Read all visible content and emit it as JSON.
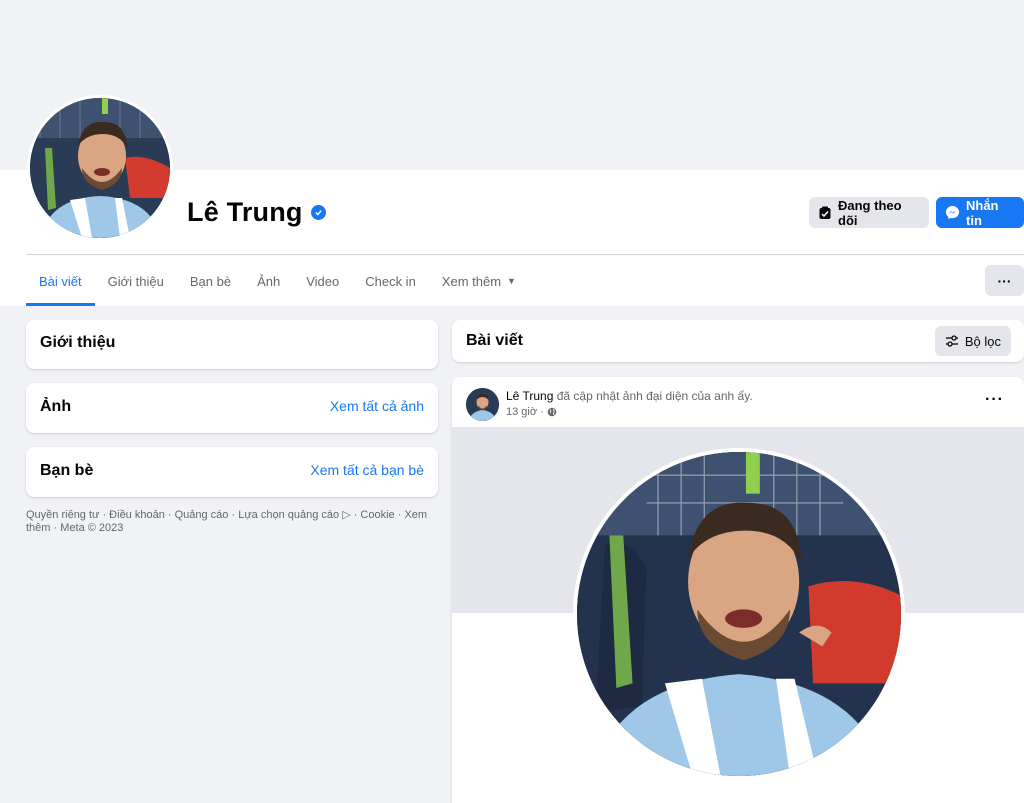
{
  "profile": {
    "name": "Lê Trung",
    "verified_icon": "verified-badge-icon"
  },
  "actions": {
    "follow_label": "Đang theo dõi",
    "message_label": "Nhắn tin"
  },
  "tabs": [
    {
      "label": "Bài viết",
      "active": true
    },
    {
      "label": "Giới thiệu"
    },
    {
      "label": "Bạn bè"
    },
    {
      "label": "Ảnh"
    },
    {
      "label": "Video"
    },
    {
      "label": "Check in"
    },
    {
      "label": "Xem thêm"
    }
  ],
  "more_button": "···",
  "left": {
    "intro_title": "Giới thiệu",
    "photos_title": "Ảnh",
    "photos_link": "Xem tất cả ảnh",
    "friends_title": "Bạn bè",
    "friends_link": "Xem tất cả bạn bè",
    "footer": "Quyền riêng tư · Điều khoản · Quảng cáo · Lựa chọn quảng cáo ▷ · Cookie · Xem thêm · Meta © 2023"
  },
  "posts": {
    "title": "Bài viết",
    "filter_label": "Bộ lọc",
    "post": {
      "author": "Lê Trung",
      "action": "đã cập nhật ảnh đại diện của anh ấy.",
      "time": "13 giờ ·",
      "menu": "···"
    }
  },
  "colors": {
    "accent": "#1877f2",
    "background": "#f0f2f5",
    "button_gray": "#e4e6eb"
  }
}
